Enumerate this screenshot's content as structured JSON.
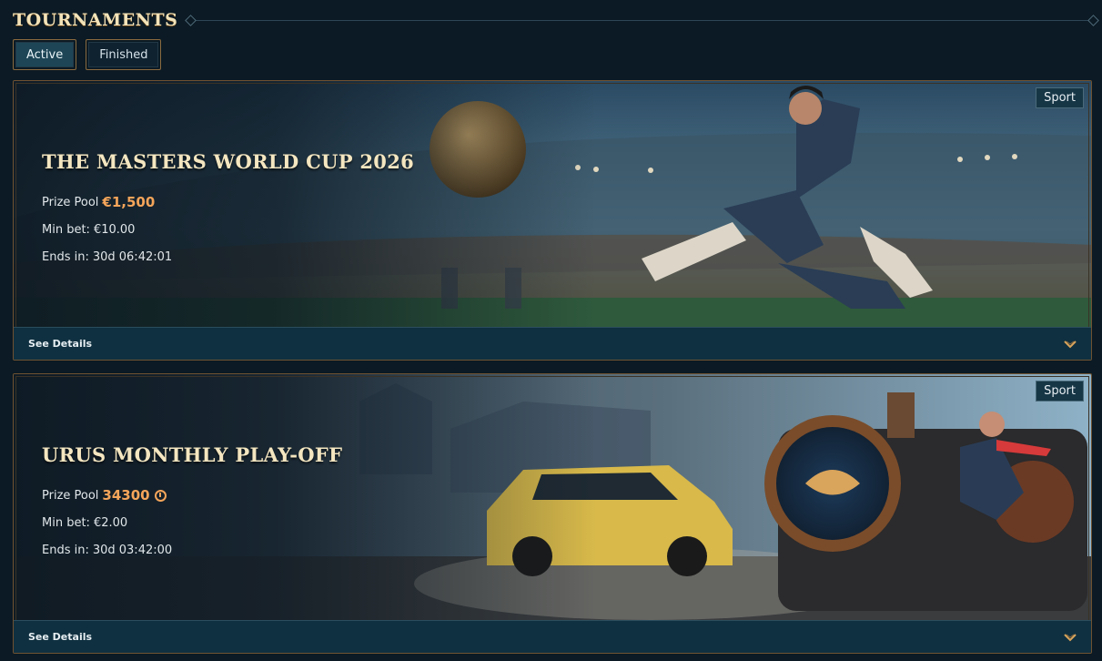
{
  "header": {
    "title": "TOURNAMENTS"
  },
  "tabs": [
    {
      "label": "Active",
      "active": true
    },
    {
      "label": "Finished",
      "active": false
    }
  ],
  "tournaments": [
    {
      "title": "THE MASTERS WORLD CUP 2026",
      "category": "Sport",
      "prize_label": "Prize Pool",
      "prize_value": "€1,500",
      "prize_icon": null,
      "min_bet_label": "Min bet:",
      "min_bet_value": "€10.00",
      "ends_label": "Ends in:",
      "ends_value": "30d 06:42:01",
      "details_label": "See Details",
      "artwork": "football-stadium-player"
    },
    {
      "title": "URUS MONTHLY PLAY-OFF",
      "category": "Sport",
      "prize_label": "Prize Pool",
      "prize_value": "34300",
      "prize_icon": "coin-icon",
      "min_bet_label": "Min bet:",
      "min_bet_value": "€2.00",
      "ends_label": "Ends in:",
      "ends_value": "30d 03:42:00",
      "details_label": "See Details",
      "artwork": "yellow-suv-steam-train"
    }
  ],
  "colors": {
    "background": "#0b1a24",
    "title": "#f3e3b8",
    "prize": "#f5a55a",
    "frame": "#6f5232",
    "details_bar": "#0f3040"
  }
}
